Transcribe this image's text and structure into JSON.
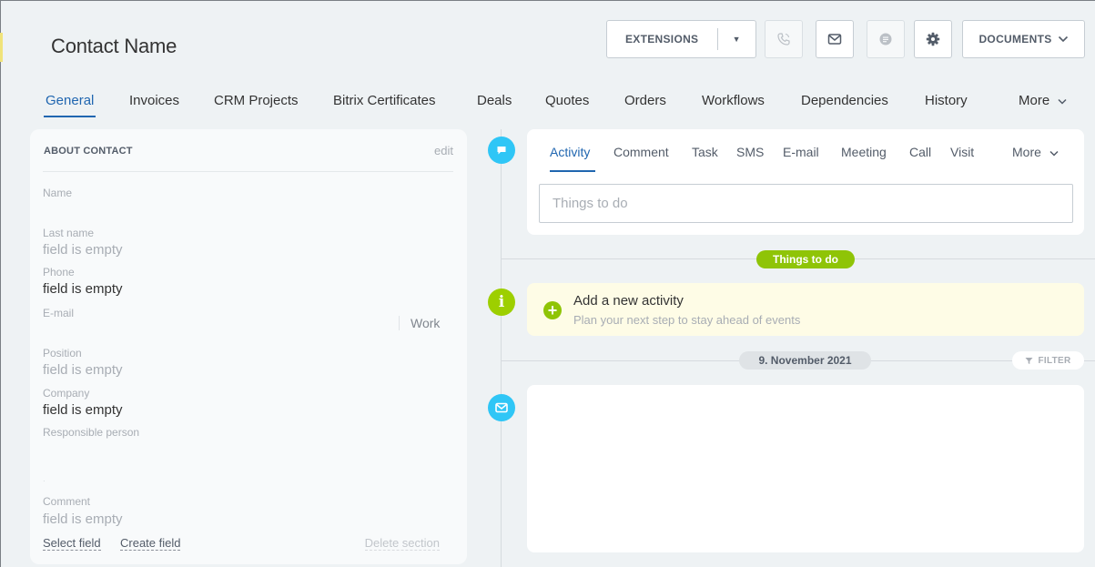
{
  "header": {
    "title": "Contact Name",
    "extensions_label": "EXTENSIONS",
    "documents_label": "DOCUMENTS",
    "icons": [
      "phone-icon",
      "envelope-icon",
      "chat-icon",
      "gear-icon"
    ]
  },
  "tabs": [
    {
      "label": "General",
      "active": true
    },
    {
      "label": "Invoices"
    },
    {
      "label": "CRM Projects"
    },
    {
      "label": "Bitrix Certificates"
    },
    {
      "label": "Deals"
    },
    {
      "label": "Quotes"
    },
    {
      "label": "Orders"
    },
    {
      "label": "Workflows"
    },
    {
      "label": "Dependencies"
    },
    {
      "label": "History"
    },
    {
      "label": "More"
    }
  ],
  "about": {
    "heading": "ABOUT CONTACT",
    "edit": "edit",
    "fields": {
      "name_label": "Name",
      "last_name_label": "Last name",
      "last_name_value": "field is empty",
      "phone_label": "Phone",
      "phone_value": "field is empty",
      "email_label": "E-mail",
      "email_type": "Work",
      "position_label": "Position",
      "position_value": "field is empty",
      "company_label": "Company",
      "company_value": "field is empty",
      "responsible_label": "Responsible person",
      "comment_label": "Comment",
      "comment_value": "field is empty"
    },
    "select_field": "Select field",
    "create_field": "Create field",
    "delete_section": "Delete section"
  },
  "activity": {
    "tabs": [
      {
        "label": "Activity",
        "active": true
      },
      {
        "label": "Comment"
      },
      {
        "label": "Task"
      },
      {
        "label": "SMS"
      },
      {
        "label": "E-mail"
      },
      {
        "label": "Meeting"
      },
      {
        "label": "Call"
      },
      {
        "label": "Visit"
      },
      {
        "label": "More"
      }
    ],
    "placeholder": "Things to do"
  },
  "timeline": {
    "things_to_do": "Things to do",
    "new_activity_title": "Add a new activity",
    "new_activity_sub": "Plan your next step to stay ahead of events",
    "date": "9. November 2021",
    "filter": "FILTER"
  },
  "colors": {
    "accent_blue": "#2066b0",
    "timeline_blue": "#2fc6f6",
    "timeline_green": "#9dcf00",
    "pill_green": "#8fc407"
  }
}
